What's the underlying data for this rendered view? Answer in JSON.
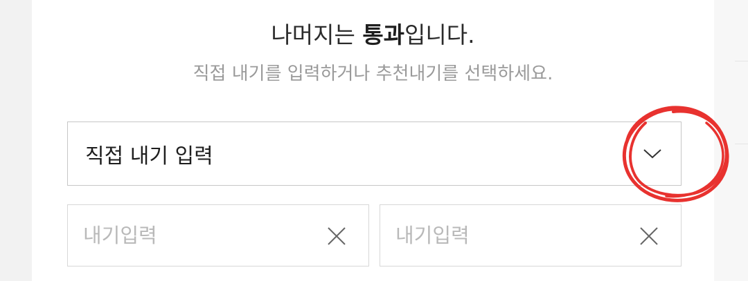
{
  "header": {
    "title_prefix": "나머지는 ",
    "title_bold": "통과",
    "title_suffix": "입니다.",
    "subtitle": "직접 내기를 입력하거나 추천내기를 선택하세요."
  },
  "bet_select": {
    "selected_label": "직접 내기 입력"
  },
  "bet_inputs": [
    {
      "placeholder": "내기입력",
      "value": ""
    },
    {
      "placeholder": "내기입력",
      "value": ""
    }
  ],
  "colors": {
    "annotation_circle": "#e8322f",
    "title_text": "#2b2b2b",
    "subtitle_text": "#9a9a9a",
    "placeholder_text": "#b9b9b9",
    "border": "#c6c6c6"
  },
  "icons": {
    "dropdown": "chevron-down-icon",
    "clear": "close-icon"
  }
}
